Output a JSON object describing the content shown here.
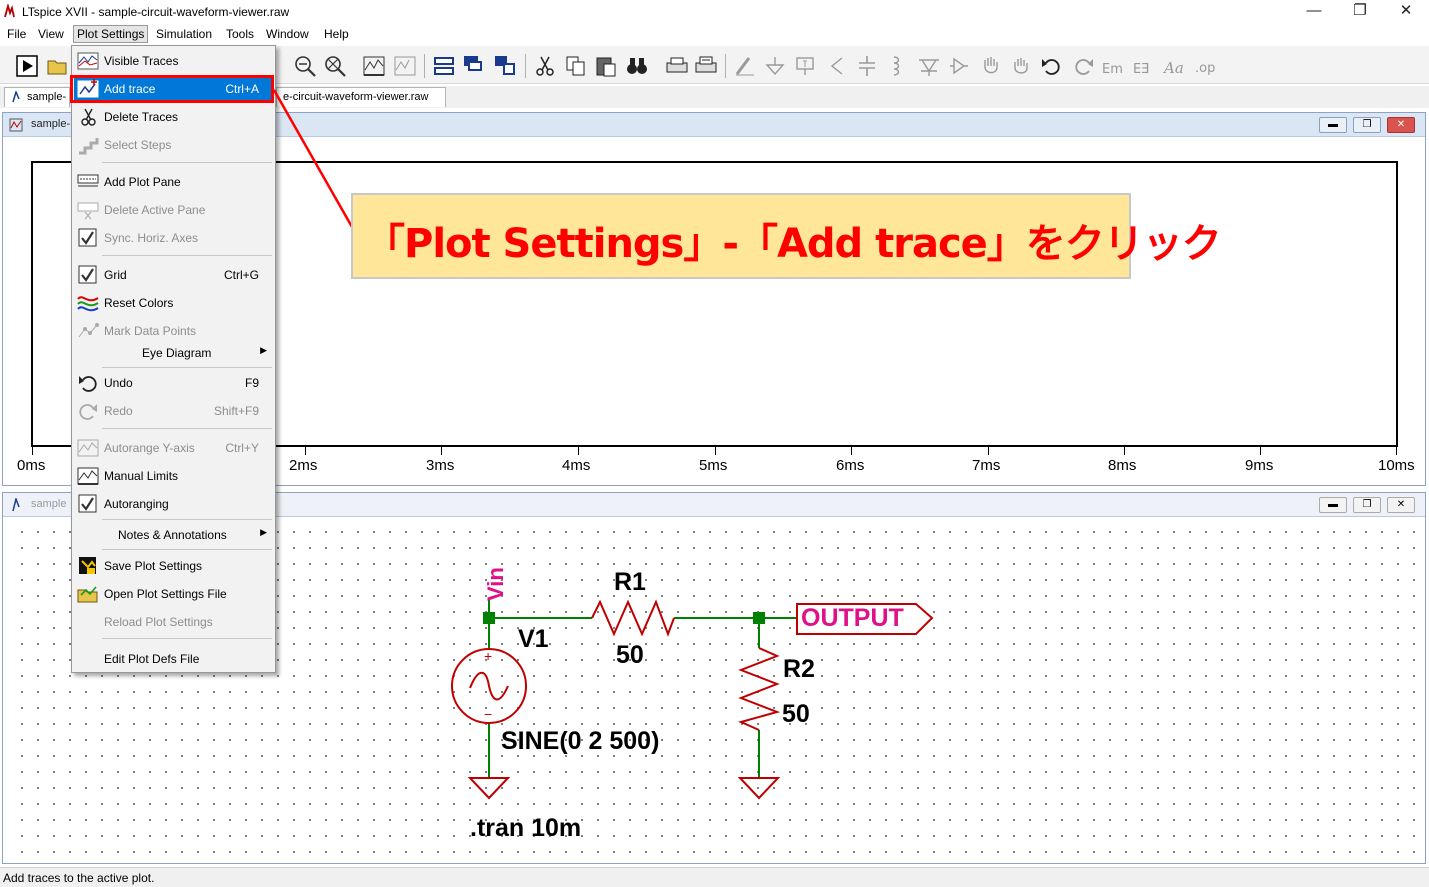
{
  "window": {
    "title": "LTspice XVII - sample-circuit-waveform-viewer.raw",
    "minimize": "—",
    "maximize": "❐",
    "close": "✕"
  },
  "menubar": [
    "File",
    "View",
    "Plot Settings",
    "Simulation",
    "Tools",
    "Window",
    "Help"
  ],
  "tabs": {
    "tab1": "sample-",
    "tab2": "e-circuit-waveform-viewer.raw"
  },
  "plot_window": {
    "caption": "sample-",
    "x_labels": [
      "0ms",
      "2ms",
      "3ms",
      "4ms",
      "5ms",
      "6ms",
      "7ms",
      "8ms",
      "9ms",
      "10ms"
    ]
  },
  "schematic_window": {
    "caption": "sample"
  },
  "schematic": {
    "net_vin": "Vin",
    "r1_name": "R1",
    "r1_value": "50",
    "v1_name": "V1",
    "v1_value": "SINE(0 2 500)",
    "r2_name": "R2",
    "r2_value": "50",
    "output_label": "OUTPUT",
    "tran_directive": ".tran 10m",
    "plus": "+",
    "minus": "−"
  },
  "dropdown": {
    "items": [
      {
        "label": "Visible Traces",
        "shortcut": ""
      },
      {
        "label": "Add trace",
        "shortcut": "Ctrl+A"
      },
      {
        "label": "Delete Traces",
        "shortcut": ""
      },
      {
        "label": "Select Steps",
        "shortcut": ""
      },
      {
        "label": "Add Plot Pane",
        "shortcut": ""
      },
      {
        "label": "Delete Active Pane",
        "shortcut": ""
      },
      {
        "label": "Sync. Horiz. Axes",
        "shortcut": ""
      },
      {
        "label": "Grid",
        "shortcut": "Ctrl+G"
      },
      {
        "label": "Reset Colors",
        "shortcut": ""
      },
      {
        "label": "Mark Data Points",
        "shortcut": ""
      },
      {
        "label": "Eye Diagram",
        "shortcut": ""
      },
      {
        "label": "Undo",
        "shortcut": "F9"
      },
      {
        "label": "Redo",
        "shortcut": "Shift+F9"
      },
      {
        "label": "Autorange Y-axis",
        "shortcut": "Ctrl+Y"
      },
      {
        "label": "Manual Limits",
        "shortcut": ""
      },
      {
        "label": "Autoranging",
        "shortcut": ""
      },
      {
        "label": "Notes & Annotations",
        "shortcut": ""
      },
      {
        "label": "Save Plot Settings",
        "shortcut": ""
      },
      {
        "label": "Open Plot Settings File",
        "shortcut": ""
      },
      {
        "label": "Reload Plot Settings",
        "shortcut": ""
      },
      {
        "label": "Edit Plot Defs File",
        "shortcut": ""
      }
    ],
    "submenu_arrow": "▶"
  },
  "callout": "「Plot Settings」-「Add trace」をクリック",
  "statusbar": "Add traces to the active plot.",
  "colors": {
    "highlight": "#0078d7",
    "annotation_red": "#ff0000",
    "callout_bg": "#ffe699",
    "wire_green": "#008000",
    "component_red": "#c00000",
    "label_magenta": "#e0108a"
  }
}
